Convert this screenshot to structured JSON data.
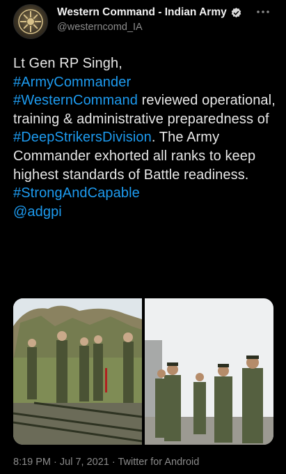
{
  "account": {
    "display_name": "Western Command - Indian Army",
    "handle": "@westerncomd_IA",
    "verified": true,
    "avatar_icon": "indian-army-emblem-icon"
  },
  "tweet": {
    "line_1": "Lt Gen RP Singh,",
    "hashtag_1": "#ArmyCommander",
    "hashtag_2": "#WesternCommand",
    "text_2": " reviewed operational, training & administrative preparedness of ",
    "hashtag_3": "#DeepStrikersDivision",
    "text_3": ". The Army Commander exhorted all ranks to keep highest standards of Battle readiness.",
    "hashtag_4": "#StrongAndCapable",
    "mention": "@adgpi"
  },
  "media": {
    "count": 2
  },
  "meta": {
    "time": "8:19 PM",
    "separator": " · ",
    "date": "Jul 7, 2021",
    "source": "Twitter for Android"
  },
  "colors": {
    "background": "#000000",
    "link": "#1d9bf0",
    "secondary_text": "#8b8b8b",
    "primary_text": "#e7e7e7"
  }
}
